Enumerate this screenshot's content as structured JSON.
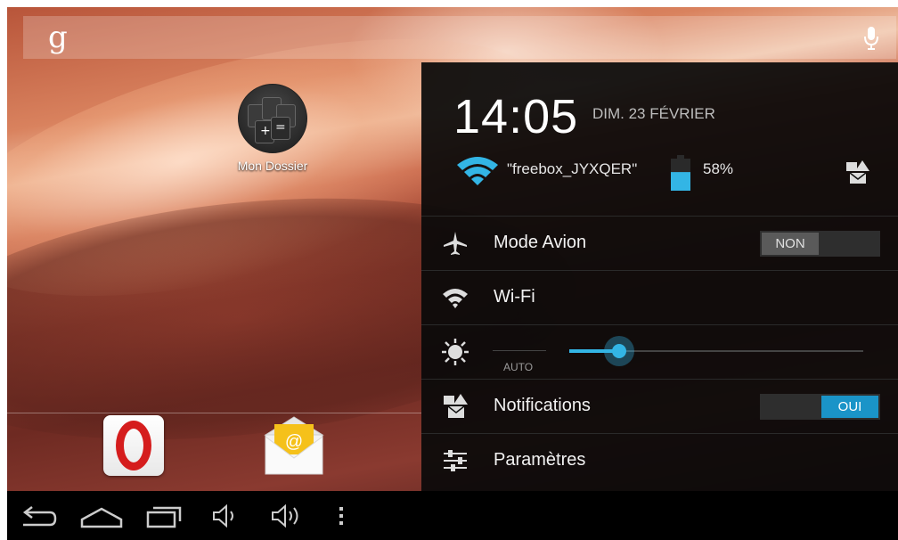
{
  "search": {
    "logo": "g"
  },
  "home": {
    "folder_label": "Mon Dossier"
  },
  "quick_settings": {
    "time": "14:05",
    "date": "DIM. 23 FÉVRIER",
    "ssid": "\"freebox_JYXQER\"",
    "battery": "58%",
    "battery_level": 0.58,
    "rows": {
      "airplane": {
        "label": "Mode Avion",
        "toggle": "NON"
      },
      "wifi": {
        "label": "Wi-Fi"
      },
      "brightness": {
        "auto_label": "AUTO",
        "level": 0.17
      },
      "notifications": {
        "label": "Notifications",
        "toggle": "OUI"
      },
      "settings": {
        "label": "Paramètres"
      }
    }
  },
  "colors": {
    "accent": "#33b5e5",
    "toggle_on": "#1a94c8",
    "opera_red": "#d51d1d"
  },
  "icons": {
    "search_bar": [
      "google-g-icon",
      "mic-icon"
    ],
    "status": [
      "wifi-icon",
      "battery-icon",
      "notification-icon"
    ],
    "rows": [
      "airplane-icon",
      "wifi-icon",
      "brightness-icon",
      "notification-icon",
      "settings-sliders-icon"
    ],
    "dock": [
      "opera-icon",
      "email-icon"
    ],
    "nav": [
      "back-icon",
      "home-icon",
      "recent-apps-icon",
      "volume-down-icon",
      "volume-up-icon",
      "menu-icon"
    ]
  }
}
